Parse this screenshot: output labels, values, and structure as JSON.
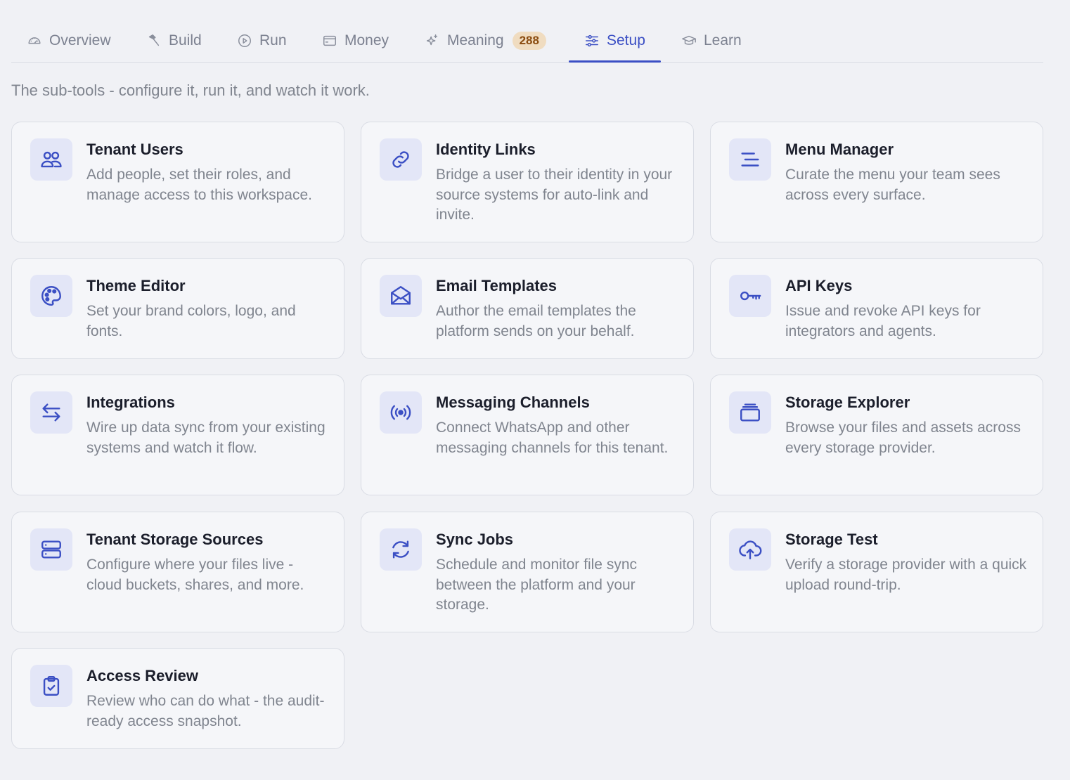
{
  "tabs": [
    {
      "label": "Overview",
      "icon": "gauge-icon"
    },
    {
      "label": "Build",
      "icon": "hammer-icon"
    },
    {
      "label": "Run",
      "icon": "play-circle-icon"
    },
    {
      "label": "Money",
      "icon": "wallet-icon"
    },
    {
      "label": "Meaning",
      "icon": "sparkle-icon",
      "badge": "288"
    },
    {
      "label": "Setup",
      "icon": "sliders-icon",
      "active": true
    },
    {
      "label": "Learn",
      "icon": "graduation-cap-icon"
    }
  ],
  "subtitle": "The sub-tools - configure it, run it, and watch it work.",
  "accent_color": "#3b4fc4",
  "badge_color": "#f0dcc0",
  "cards": [
    {
      "title": "Tenant Users",
      "desc": "Add people, set their roles, and manage access to this workspace.",
      "icon": "users-icon"
    },
    {
      "title": "Identity Links",
      "desc": "Bridge a user to their identity in your source systems for auto-link and invite.",
      "icon": "link-icon"
    },
    {
      "title": "Menu Manager",
      "desc": "Curate the menu your team sees across every surface.",
      "icon": "menu-lines-icon"
    },
    {
      "title": "Theme Editor",
      "desc": "Set your brand colors, logo, and fonts.",
      "icon": "palette-icon"
    },
    {
      "title": "Email Templates",
      "desc": "Author the email templates the platform sends on your behalf.",
      "icon": "envelope-icon"
    },
    {
      "title": "API Keys",
      "desc": "Issue and revoke API keys for integrators and agents.",
      "icon": "key-icon"
    },
    {
      "title": "Integrations",
      "desc": "Wire up data sync from your existing systems and watch it flow.",
      "icon": "arrows-swap-icon"
    },
    {
      "title": "Messaging Channels",
      "desc": "Connect WhatsApp and other messaging channels for this tenant.",
      "icon": "broadcast-icon"
    },
    {
      "title": "Storage Explorer",
      "desc": "Browse your files and assets across every storage provider.",
      "icon": "stack-icon"
    },
    {
      "title": "Tenant Storage Sources",
      "desc": "Configure where your files live - cloud buckets, shares, and more.",
      "icon": "server-icon"
    },
    {
      "title": "Sync Jobs",
      "desc": "Schedule and monitor file sync between the platform and your storage.",
      "icon": "refresh-icon"
    },
    {
      "title": "Storage Test",
      "desc": "Verify a storage provider with a quick upload round-trip.",
      "icon": "cloud-upload-icon"
    },
    {
      "title": "Access Review",
      "desc": "Review who can do what - the audit-ready access snapshot.",
      "icon": "clipboard-check-icon"
    }
  ]
}
